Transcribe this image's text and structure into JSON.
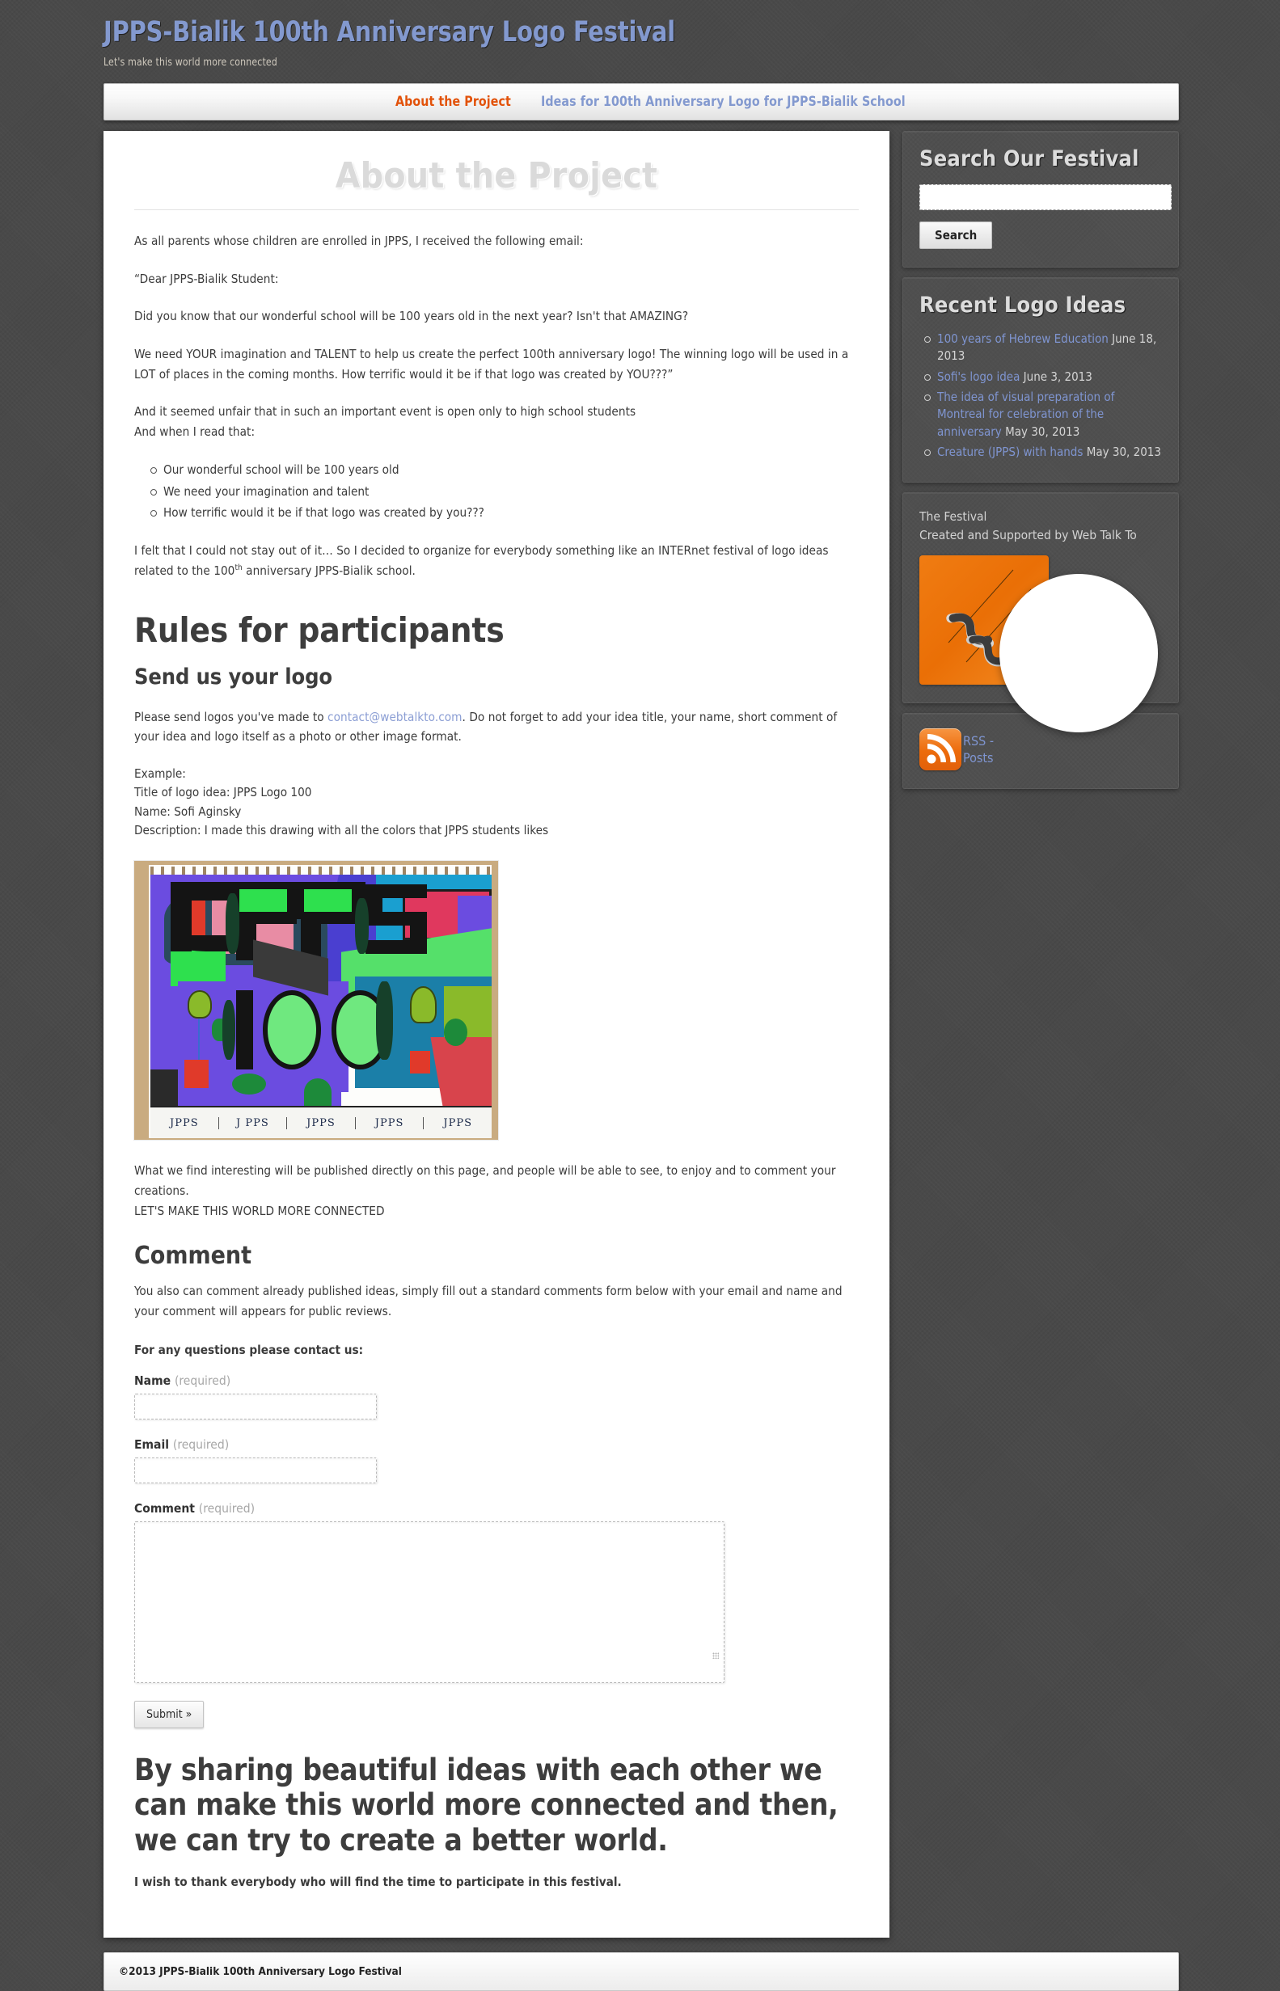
{
  "site": {
    "title": "JPPS-Bialik 100th Anniversary Logo Festival",
    "tagline": "Let's make this world more connected"
  },
  "nav": {
    "items": [
      {
        "label": "About the Project",
        "active": true
      },
      {
        "label": "Ideas for 100th Anniversary Logo for JPPS-Bialik School",
        "active": false
      }
    ]
  },
  "main": {
    "page_title": "About the Project",
    "intro": "As all parents whose children are enrolled in JPPS, I received the following email:",
    "salutation": "“Dear JPPS-Bialik Student:",
    "para_amazing": "Did you know that our wonderful school will be 100 years old in the next year? Isn't that AMAZING?",
    "para_talent": "We need YOUR imagination and TALENT to help us create the perfect 100th anniversary logo!  The winning logo will be used in a LOT of places in the coming months. How terrific would it be if that logo was created by YOU???”",
    "para_unfair_1": "And it seemed unfair that in such an important event is open only to high school students",
    "para_unfair_2": "And when I read that:",
    "bullets": [
      "Our wonderful school will be 100 years old",
      "We need your imagination and talent",
      "How terrific would it be if that logo was created by you???"
    ],
    "para_felt_a": "I felt that I could not stay out of it… So I decided to organize for everybody something like an INTERnet festival of logo ideas related to the 100",
    "para_felt_sup": "th",
    "para_felt_b": " anniversary JPPS-Bialik school.",
    "rules_heading": "Rules for participants",
    "send_heading": "Send us your logo",
    "send_text_a": "Please send logos you've made to ",
    "send_email": "contact@webtalkto.com",
    "send_text_b": ". Do not forget to add your idea title, your name, short comment of your idea and logo itself as a photo or other image format.",
    "example": {
      "label": "Example:",
      "title_line": "Title of logo idea: JPPS Logo 100",
      "name_line": "Name: Sofi Aginsky",
      "description_line": "Description: I made this drawing with all the colors that JPPS students likes"
    },
    "drawing": {
      "alt": "Child's marker drawing reading JPPS 100 in colorful blocks on spiral sketchbook paper",
      "bottom_labels": [
        "JPPS",
        "J PPS",
        "JPPS",
        "JPPS",
        "JPPS"
      ]
    },
    "published_text": "What we find interesting will be published directly on this page, and people will be able to see, to enjoy and to comment your creations.",
    "connected_text": "LET'S MAKE THIS WORLD MORE CONNECTED",
    "comment_heading": "Comment",
    "comment_text": "You also can comment already published ideas, simply fill out a standard comments form below with your email and name and your comment will appears for public reviews.",
    "contact_note": "For any questions please contact us:",
    "form": {
      "name_label": "Name",
      "name_required": "(required)",
      "name_value": "",
      "email_label": "Email",
      "email_required": "(required)",
      "email_value": "",
      "comment_label": "Comment",
      "comment_required": "(required)",
      "comment_value": "",
      "submit_label": "Submit »"
    },
    "closing_heading": "By sharing beautiful ideas with each other we can make this world more connected and then, we can try to create a better world.",
    "thanks": "I wish to thank everybody who will find the time to participate in this festival."
  },
  "sidebar": {
    "search": {
      "title": "Search Our Festival",
      "value": "",
      "placeholder": "",
      "button_label": "Search"
    },
    "recent": {
      "title": "Recent Logo Ideas",
      "items": [
        {
          "title": "100 years of Hebrew Education",
          "date": "June 18, 2013"
        },
        {
          "title": "Sofi's logo idea",
          "date": "June 3, 2013"
        },
        {
          "title": "The idea of visual preparation of Montreal for celebration of the anniversary",
          "date": "May 30, 2013"
        },
        {
          "title": "Creature (JPPS) with hands",
          "date": "May 30, 2013"
        }
      ]
    },
    "festival": {
      "line1": "The Festival",
      "line2": "Created and Supported by Web Talk To"
    },
    "rss": {
      "label": "RSS - Posts"
    }
  },
  "footer": {
    "text": "©2013 JPPS-Bialik 100th Anniversary Logo Festival"
  },
  "colors": {
    "brand_blue": "#8399cf",
    "active_orange": "#e2520a",
    "page_bg": "#494949",
    "rss_orange": "#ec6b0b"
  }
}
